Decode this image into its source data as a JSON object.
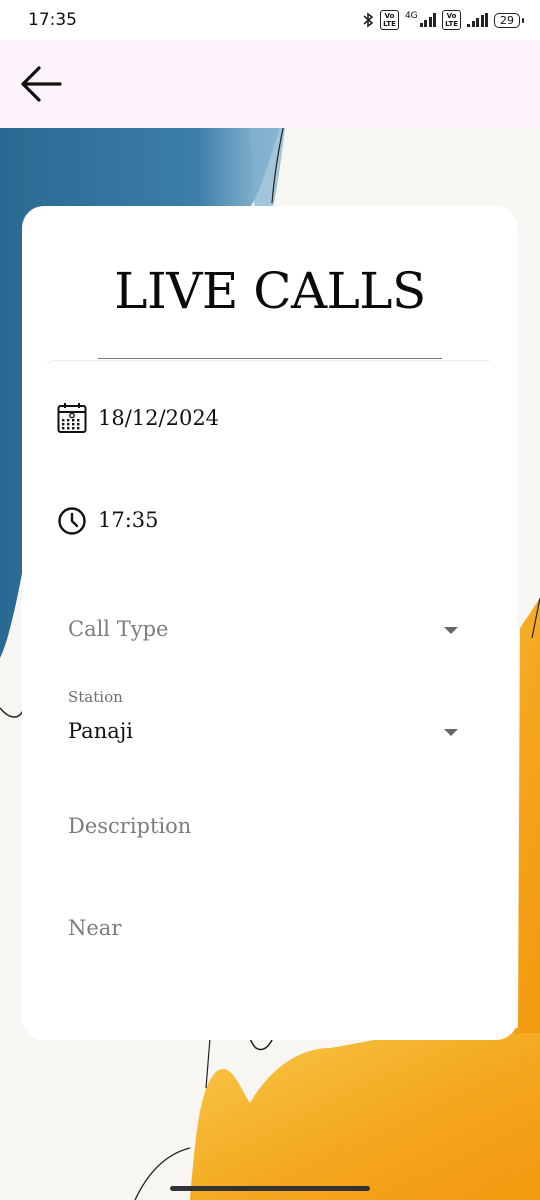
{
  "status_bar": {
    "time": "17:35",
    "network_label": "4G",
    "volte_label": "Vo LTE",
    "battery": "29"
  },
  "header": {
    "back_icon": "arrow-left-icon"
  },
  "form": {
    "title": "LIVE CALLS",
    "date": {
      "icon": "calendar-icon",
      "value": "18/12/2024"
    },
    "time": {
      "icon": "clock-icon",
      "value": "17:35"
    },
    "call_type": {
      "placeholder": "Call Type"
    },
    "station": {
      "label": "Station",
      "value": "Panaji"
    },
    "description": {
      "placeholder": "Description"
    },
    "near": {
      "placeholder": "Near"
    }
  },
  "colors": {
    "app_bar": "#fdf3fb",
    "card": "#ffffff",
    "watercolor_blue": "#2f6e96",
    "watercolor_orange": "#f4a51c"
  }
}
